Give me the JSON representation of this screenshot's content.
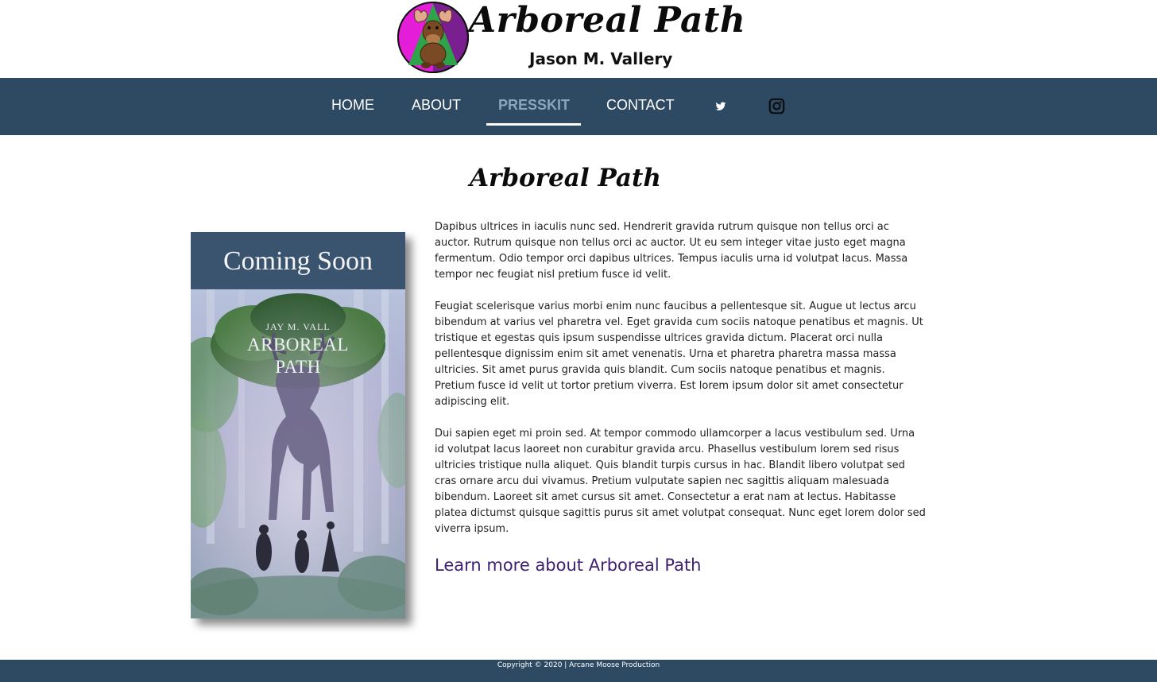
{
  "brand": {
    "title": "Arboreal Path",
    "author": "Jason M. Vallery",
    "logo_icon": "moose-logo-icon",
    "logo_colors": {
      "left": "#e41ed8",
      "right": "#7a1f8f",
      "triangle": "#2fa34a",
      "moose": "#7a4a24"
    }
  },
  "nav": {
    "items": [
      {
        "label": "HOME",
        "active": false
      },
      {
        "label": "ABOUT",
        "active": false
      },
      {
        "label": "PRESSKIT",
        "active": true
      },
      {
        "label": "CONTACT",
        "active": false
      }
    ],
    "icons": [
      "twitter-icon",
      "instagram-icon"
    ]
  },
  "main": {
    "title": "Arboreal Path",
    "cover": {
      "banner": "Coming Soon",
      "author": "JAY M. VALL",
      "book_title_line1": "ARBOREAL",
      "book_title_line2": "PATH"
    },
    "paragraphs": [
      "Dapibus ultrices in iaculis nunc sed. Hendrerit gravida rutrum quisque non tellus orci ac auctor. Rutrum quisque non tellus orci ac auctor. Ut eu sem integer vitae justo eget magna fermentum. Odio tempor orci dapibus ultrices. Tempus iaculis urna id volutpat lacus. Massa tempor nec feugiat nisl pretium fusce id velit.",
      "Feugiat scelerisque varius morbi enim nunc faucibus a pellentesque sit. Augue ut lectus arcu bibendum at varius vel pharetra vel. Eget gravida cum sociis natoque penatibus et magnis. Ut tristique et egestas quis ipsum suspendisse ultrices gravida dictum. Placerat orci nulla pellentesque dignissim enim sit amet venenatis. Urna et pharetra pharetra massa massa ultricies. Sit amet purus gravida quis blandit. Cum sociis natoque penatibus et magnis. Pretium fusce id velit ut tortor pretium viverra. Est lorem ipsum dolor sit amet consectetur adipiscing elit.",
      "Dui sapien eget mi proin sed. At tempor commodo ullamcorper a lacus vestibulum sed. Urna id volutpat lacus laoreet non curabitur gravida arcu. Phasellus vestibulum lorem sed risus ultricies tristique nulla aliquet. Quis blandit turpis cursus in hac. Blandit libero volutpat sed cras ornare arcu dui vivamus. Pretium vulputate sapien nec sagittis aliquam malesuada bibendum. Laoreet sit amet cursus sit amet. Consectetur a erat nam at lectus. Habitasse platea dictumst quisque sagittis purus sit amet volutpat consequat. Nunc eget lorem dolor sed viverra ipsum."
    ],
    "link": "Learn more about Arboreal Path"
  },
  "footer": {
    "text": "Copyright © 2020 | Arcane Moose Production"
  },
  "colors": {
    "nav_bg": "#2e4a63",
    "nav_active": "#8aa5bb",
    "link": "#3d1f6e"
  }
}
